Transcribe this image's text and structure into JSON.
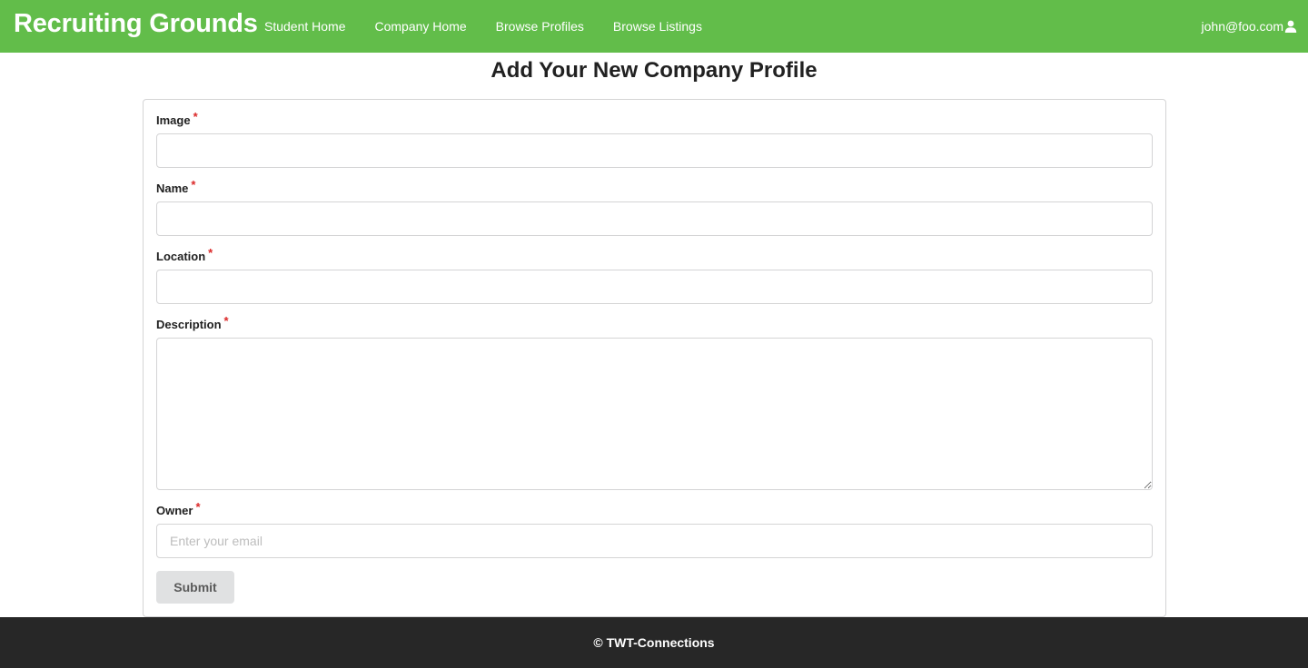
{
  "navbar": {
    "brand": "Recruiting Grounds",
    "links": [
      "Student Home",
      "Company Home",
      "Browse Profiles",
      "Browse Listings"
    ],
    "user_email": "john@foo.com",
    "user_icon": "user-icon",
    "background_color": "#62bd4a"
  },
  "page": {
    "title": "Add Your New Company Profile"
  },
  "form": {
    "required_marker": "*",
    "image_label": "Image",
    "image_value": "",
    "name_label": "Name",
    "name_value": "",
    "location_label": "Location",
    "location_value": "",
    "description_label": "Description",
    "description_value": "",
    "owner_label": "Owner",
    "owner_value": "",
    "owner_placeholder": "Enter your email",
    "submit_label": "Submit"
  },
  "footer": {
    "text": "© TWT-Connections",
    "background_color": "#272727"
  }
}
